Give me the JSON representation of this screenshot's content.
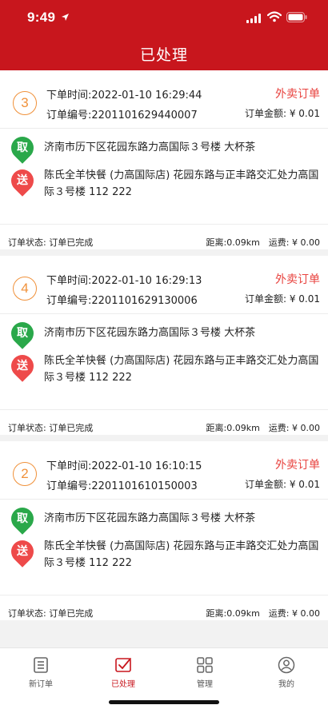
{
  "status_bar": {
    "time": "9:49"
  },
  "nav": {
    "title": "已处理"
  },
  "orders": [
    {
      "index": "3",
      "time": "下单时间:2022-01-10 16:29:44",
      "type": "外卖订单",
      "no": "订单编号:2201101629440007",
      "amount": "订单金额: ¥ 0.01",
      "pickup_tag": "取",
      "pickup_addr": "济南市历下区花园东路力高国际３号楼 大杯茶",
      "deliver_tag": "送",
      "deliver_addr": "陈氏全羊快餐 (力高国际店) 花园东路与正丰路交汇处力高国际３号楼 112 222",
      "status": "订单状态: 订单已完成",
      "distance": "距离:0.09km　运费: ¥ 0.00"
    },
    {
      "index": "4",
      "time": "下单时间:2022-01-10 16:29:13",
      "type": "外卖订单",
      "no": "订单编号:2201101629130006",
      "amount": "订单金额: ¥ 0.01",
      "pickup_tag": "取",
      "pickup_addr": "济南市历下区花园东路力高国际３号楼 大杯茶",
      "deliver_tag": "送",
      "deliver_addr": "陈氏全羊快餐 (力高国际店) 花园东路与正丰路交汇处力高国际３号楼 112 222",
      "status": "订单状态: 订单已完成",
      "distance": "距离:0.09km　运费: ¥ 0.00"
    },
    {
      "index": "2",
      "time": "下单时间:2022-01-10 16:10:15",
      "type": "外卖订单",
      "no": "订单编号:2201101610150003",
      "amount": "订单金额: ¥ 0.01",
      "pickup_tag": "取",
      "pickup_addr": "济南市历下区花园东路力高国际３号楼 大杯茶",
      "deliver_tag": "送",
      "deliver_addr": "陈氏全羊快餐 (力高国际店) 花园东路与正丰路交汇处力高国际３号楼 112 222",
      "status": "订单状态: 订单已完成",
      "distance": "距离:0.09km　运费: ¥ 0.00"
    }
  ],
  "tabbar": {
    "items": [
      {
        "label": "新订单",
        "icon": "list-icon"
      },
      {
        "label": "已处理",
        "icon": "processed-icon"
      },
      {
        "label": "管理",
        "icon": "grid-icon"
      },
      {
        "label": "我的",
        "icon": "user-icon"
      }
    ],
    "active_color": "#c8161d"
  },
  "colors": {
    "header": "#c8161d",
    "accent_orange": "#f0913a",
    "pickup": "#2aa84a",
    "deliver": "#ee4a4a"
  }
}
